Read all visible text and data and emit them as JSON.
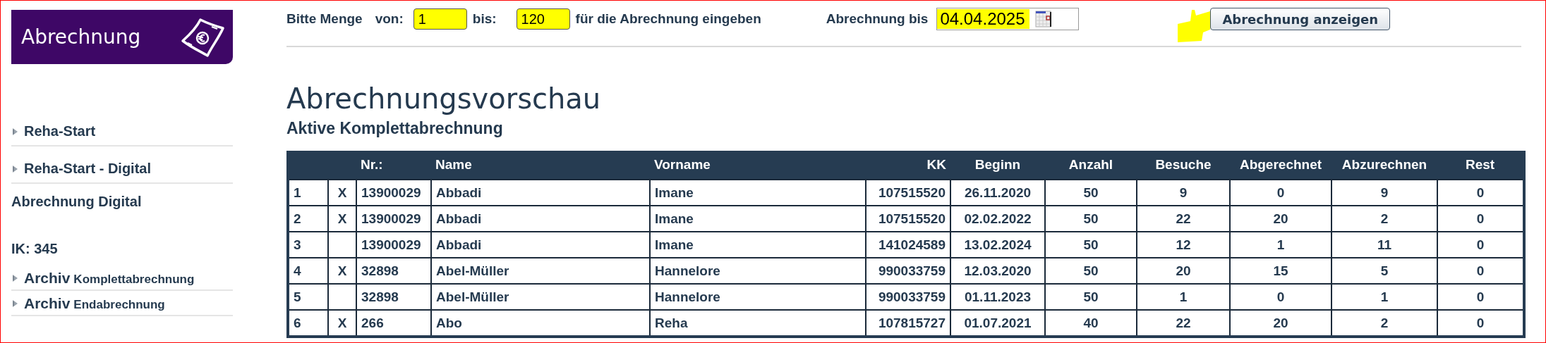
{
  "sidebar": {
    "banner": {
      "title": "Abrechnung"
    },
    "links": [
      {
        "label": "Reha-Start"
      },
      {
        "label": "Reha-Start - Digital"
      }
    ],
    "section_title": "Abrechnung Digital",
    "ik": "IK: 345",
    "archive_links": [
      {
        "lead": "Archiv",
        "rest": "Komplettabrechnung"
      },
      {
        "lead": "Archiv",
        "rest": "Endabrechnung"
      }
    ]
  },
  "filter": {
    "prompt": "Bitte Menge",
    "from_label": "von:",
    "from": {
      "value": "1",
      "highlighted": true
    },
    "to_label": "bis:",
    "to": {
      "value": "120",
      "highlighted": true
    },
    "suffix": "für die Abrechnung eingeben",
    "date_label": "Abrechnung bis",
    "date": {
      "value": "04.04.2025",
      "highlighted": true
    },
    "button": "Abrechnung anzeigen"
  },
  "heading": "Abrechnungsvorschau",
  "subheading": "Aktive Komplettabrechnung",
  "table": {
    "columns": [
      {},
      {},
      {
        "label": "Nr.:"
      },
      {
        "label": "Name"
      },
      {
        "label": "Vorname"
      },
      {
        "label": "KK"
      },
      {
        "label": "Beginn"
      },
      {
        "label": "Anzahl"
      },
      {
        "label": "Besuche"
      },
      {
        "label": "Abgerechnet"
      },
      {
        "label": "Abzurechnen"
      },
      {
        "label": "Rest"
      }
    ],
    "rows": [
      {
        "cells": [
          "1",
          "X",
          "13900029",
          "Abbadi",
          "Imane",
          "107515520",
          "26.11.2020",
          "50",
          "9",
          "0",
          "9",
          "0"
        ]
      },
      {
        "cells": [
          "2",
          "X",
          "13900029",
          "Abbadi",
          "Imane",
          "107515520",
          "02.02.2022",
          "50",
          "22",
          "20",
          "2",
          "0"
        ]
      },
      {
        "cells": [
          "3",
          null,
          "13900029",
          "Abbadi",
          "Imane",
          "141024589",
          "13.02.2024",
          "50",
          "12",
          "1",
          "11",
          "0"
        ]
      },
      {
        "cells": [
          "4",
          "X",
          "32898",
          "Abel-Müller",
          "Hannelore",
          "990033759",
          "12.03.2020",
          "50",
          "20",
          "15",
          "5",
          "0"
        ]
      },
      {
        "cells": [
          "5",
          null,
          "32898",
          "Abel-Müller",
          "Hannelore",
          "990033759",
          "01.11.2023",
          "50",
          "1",
          "0",
          "1",
          "0"
        ]
      },
      {
        "cells": [
          "6",
          "X",
          "266",
          "Abo",
          "Reha",
          "107815727",
          "01.07.2021",
          "40",
          "22",
          "20",
          "2",
          "0"
        ]
      }
    ]
  }
}
